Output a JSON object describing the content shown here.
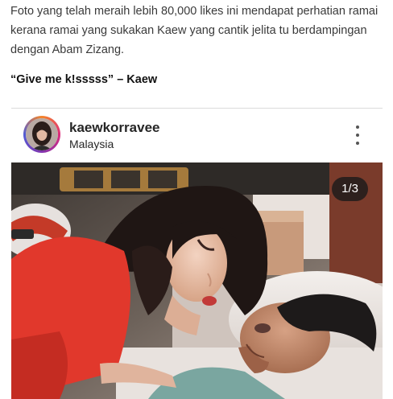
{
  "article": {
    "paragraph": "Foto yang telah meraih lebih 80,000 likes ini mendapat perhatian ramai kerana ramai yang sukakan Kaew yang cantik jelita tu berdampingan dengan Abam Zizang.",
    "quote": "“Give me k!sssss” – Kaew"
  },
  "instagram_post": {
    "username": "kaewkorravee",
    "location": "Malaysia",
    "more_icon": "more-vertical-icon",
    "carousel_counter": "1/3"
  },
  "colors": {
    "text": "#3a3a3a",
    "border": "#dbdbdb",
    "counter_bg": "#1a1a1a"
  }
}
